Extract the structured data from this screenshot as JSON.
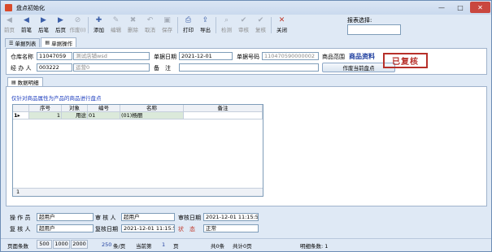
{
  "window": {
    "title": "盘点初始化",
    "min": "—",
    "max": "□",
    "close": "✕"
  },
  "toolbar": [
    {
      "label": "前页",
      "icon": "◀",
      "enabled": false
    },
    {
      "label": "前笔",
      "icon": "◀",
      "enabled": true
    },
    {
      "label": "后笔",
      "icon": "▶",
      "enabled": true
    },
    {
      "label": "后页",
      "icon": "▶",
      "enabled": true
    },
    {
      "label": "作废(I)",
      "icon": "⊘",
      "enabled": false
    },
    {
      "label": "添加",
      "icon": "✚",
      "enabled": true
    },
    {
      "label": "编辑",
      "icon": "✎",
      "enabled": false
    },
    {
      "label": "删除",
      "icon": "✖",
      "enabled": false
    },
    {
      "label": "取消",
      "icon": "↶",
      "enabled": false
    },
    {
      "label": "保存",
      "icon": "▣",
      "enabled": false
    },
    {
      "label": "打印",
      "icon": "⎙",
      "enabled": true
    },
    {
      "label": "导出",
      "icon": "⇪",
      "enabled": true
    },
    {
      "label": "检测",
      "icon": "⌕",
      "enabled": false
    },
    {
      "label": "审核",
      "icon": "✔",
      "enabled": false
    },
    {
      "label": "复核",
      "icon": "✔",
      "enabled": false
    },
    {
      "label": "关闭",
      "icon": "✕",
      "enabled": true
    }
  ],
  "report": {
    "label": "报表选择:",
    "value": ""
  },
  "tabs": [
    {
      "label": "单据列表",
      "icon": "☰"
    },
    {
      "label": "单据操作",
      "icon": "▤"
    }
  ],
  "header": {
    "warehouse_name_label": "仓库名称",
    "warehouse_code": "11047059",
    "warehouse_name": "测试店铺wsd",
    "date_label": "单据日期",
    "date": "2021-12-01",
    "no_label": "单据号码",
    "no": "110470590000002",
    "scope_label": "商品范围",
    "scope_value": "商品资料",
    "handler_label": "经 办 人",
    "handler_code": "003222",
    "handler_name": "运营0",
    "remark_label": "备　注",
    "remark": "",
    "void_button": "作废当前盘点",
    "stamp": "已复核"
  },
  "subtab": {
    "label": "数据明细",
    "icon": "▤"
  },
  "detail": {
    "note": "仅针对商品属性为产品的商品进行盘点",
    "columns": [
      "序号",
      "对象",
      "编号",
      "名称",
      "备注"
    ],
    "rows": [
      {
        "indicator": "1▸",
        "seq": "1",
        "object": "用途",
        "code": "01",
        "name": "(01)杨丽",
        "remark": ""
      }
    ],
    "footer_count": "1"
  },
  "audit": {
    "operator_label": "操 作 员",
    "operator": "超用户",
    "auditor_label": "审 核 人",
    "auditor": "超用户",
    "audit_date_label": "审核日期",
    "audit_date": "2021-12-01 11:15:5",
    "reviewer_label": "复 核 人",
    "reviewer": "超用户",
    "review_date_label": "复核日期",
    "review_date": "2021-12-01 11:15:5",
    "status_label": "状　态",
    "status": "正常"
  },
  "statusbar": {
    "page_rows_label": "页面条数",
    "opt1": "500",
    "opt2": "1000",
    "opt3": "2000",
    "per_page": "250",
    "per_page_unit": "条/页",
    "current_label": "当前第",
    "current": "1",
    "page_unit": "页",
    "total_rows": "共0条",
    "total_pages": "共计0页",
    "detail_count": "明细条数: 1"
  },
  "colors": {
    "accent": "#1f3f9f",
    "stamp": "#b7302a",
    "status_label": "#c0392b"
  }
}
